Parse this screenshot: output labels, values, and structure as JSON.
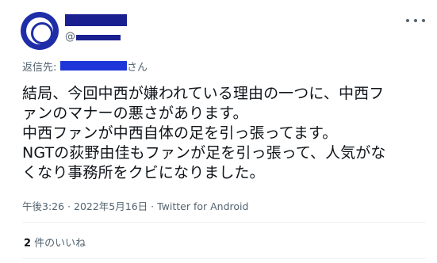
{
  "user": {
    "handle_prefix": "@"
  },
  "reply": {
    "prefix": "返信先:",
    "suffix": "さん"
  },
  "tweet": {
    "lines": [
      "結局、今回中西が嫌われている理由の一つに、中西フ",
      "ァンのマナーの悪さがあります。",
      "中西ファンが中西自体の足を引っ張ってます。",
      "NGTの荻野由佳もファンが足を引っ張って、人気がな",
      "くなり事務所をクビになりました。"
    ]
  },
  "meta": {
    "time": "午後3:26",
    "separator": " · ",
    "date": "2022年5月16日",
    "source": "Twitter for Android"
  },
  "likes": {
    "count": "2",
    "label": " 件のいいね"
  },
  "colors": {
    "redaction": "#1a2090",
    "text": "#0f1419",
    "muted": "#536471",
    "divider": "#eff3f4"
  }
}
